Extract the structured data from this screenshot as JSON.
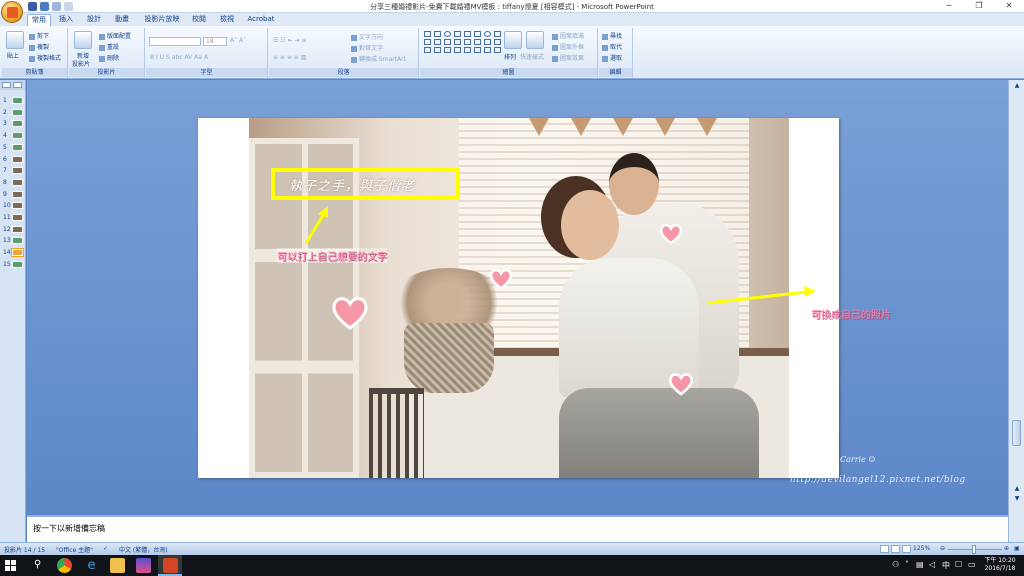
{
  "window": {
    "title": "分享三種婚禮影片-免費下載婚禮MV模板 : tiffany燈夏 [相容模式] - Microsoft PowerPoint",
    "controls": [
      "─",
      "❐",
      "✕"
    ]
  },
  "ribbon_tabs": [
    "常用",
    "插入",
    "設計",
    "動畫",
    "投影片放映",
    "校閱",
    "檢視",
    "Acrobat"
  ],
  "ribbon": {
    "clipboard": {
      "paste": "貼上",
      "cut": "剪下",
      "copy": "複製",
      "format_painter": "複製格式",
      "label": "剪貼簿"
    },
    "slides": {
      "new_slide": "新增",
      "new_slide2": "投影片",
      "layout": "版面配置",
      "reset": "重設",
      "delete": "刪除",
      "label": "投影片"
    },
    "font": {
      "size": "18",
      "label": "字型"
    },
    "paragraph": {
      "text_direction": "文字方向",
      "align_text": "對齊文字",
      "smartart": "轉換成 SmartArt",
      "label": "段落"
    },
    "drawing": {
      "arrange": "排列",
      "quick_styles": "快速樣式",
      "shape_fill": "圖案填滿",
      "shape_outline": "圖案外框",
      "shape_effects": "圖案效果",
      "label": "繪圖"
    },
    "editing": {
      "find": "尋找",
      "replace": "取代",
      "select": "選取",
      "label": "編輯"
    }
  },
  "slides_pane": {
    "numbers": [
      "1",
      "2",
      "3",
      "4",
      "5",
      "6",
      "7",
      "8",
      "9",
      "10",
      "11",
      "12",
      "13",
      "14",
      "15"
    ],
    "selected": "14"
  },
  "slide": {
    "quote": "執子之手，與子偕老",
    "annotation_text": "可以打上自己想要的文字",
    "annotation_photo": "可換成自己的照片",
    "watermark_name": "Carrie ☺",
    "watermark_url": "http://devilangel12.pixnet.net/blog",
    "heart_color": "#f597a7",
    "annotation_color": "#ff7fa8",
    "frame_color": "#ffff00"
  },
  "notes": {
    "placeholder": "按一下以新增備忘稿"
  },
  "statusbar": {
    "slide_info": "投影片 14 / 15",
    "theme": "\"Office 主題\"",
    "language": "中文 (繁體，台灣)",
    "zoom": "125%"
  },
  "taskbar": {
    "time": "下午 10:20",
    "date": "2016/7/18"
  }
}
